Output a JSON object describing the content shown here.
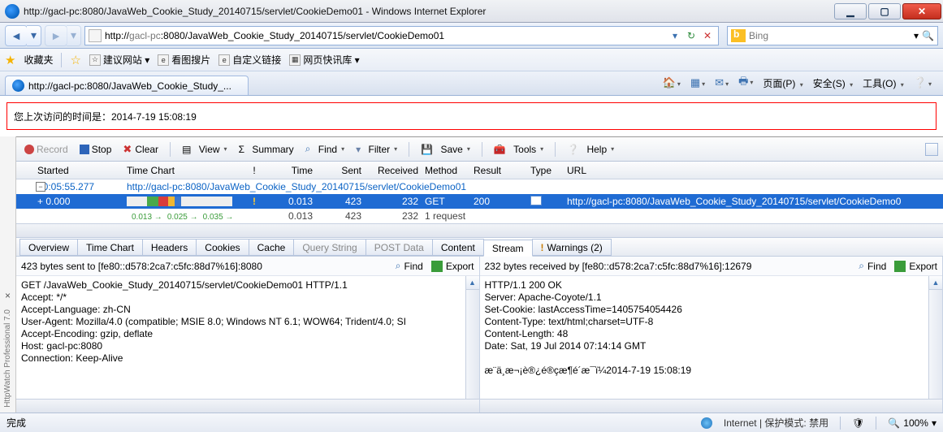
{
  "window": {
    "title": "http://gacl-pc:8080/JavaWeb_Cookie_Study_20140715/servlet/CookieDemo01 - Windows Internet Explorer",
    "url_dark1": "http://",
    "url_light1": "gacl-pc",
    "url_dark2": ":8080/JavaWeb_Cookie_Study_20140715/servlet/CookieDemo01",
    "search_hint": "Bing"
  },
  "fav": {
    "label": "收藏夹",
    "items": [
      "建议网站 ▾",
      "看图搜片",
      "自定义链接",
      "网页快讯库 ▾"
    ]
  },
  "tab": {
    "title": "http://gacl-pc:8080/JavaWeb_Cookie_Study_..."
  },
  "cmd": {
    "page": "页面(P)",
    "safety": "安全(S)",
    "tools": "工具(O)"
  },
  "page_text": "您上次访问的时间是：2014-7-19 15:08:19",
  "hw": {
    "buttons": {
      "record": "Record",
      "stop": "Stop",
      "clear": "Clear",
      "view": "View",
      "summary": "Summary",
      "find": "Find",
      "filter": "Filter",
      "save": "Save",
      "tools": "Tools",
      "help": "Help"
    },
    "cols": {
      "started": "Started",
      "chart": "Time Chart",
      "ex": "!",
      "time": "Time",
      "sent": "Sent",
      "recv": "Received",
      "meth": "Method",
      "res": "Result",
      "type": "Type",
      "url": "URL"
    },
    "rows": {
      "r0_start": "00:05:55.277",
      "r0_url": "http://gacl-pc:8080/JavaWeb_Cookie_Study_20140715/servlet/CookieDemo01",
      "r1_start": "+ 0.000",
      "r1_ex": "!",
      "r1_time": "0.013",
      "r1_sent": "423",
      "r1_recv": "232",
      "r1_meth": "GET",
      "r1_res": "200",
      "r1_url": "http://gacl-pc:8080/JavaWeb_Cookie_Study_20140715/servlet/CookieDemo0",
      "r2_c1": "0.013 →",
      "r2_c2": "0.025 →",
      "r2_c3": "0.035 →",
      "r2_time": "0.013",
      "r2_sent": "423",
      "r2_recv": "232",
      "r2_meth": "1 request"
    },
    "tabs": {
      "overview": "Overview",
      "chart": "Time Chart",
      "headers": "Headers",
      "cookies": "Cookies",
      "cache": "Cache",
      "query": "Query String",
      "post": "POST Data",
      "content": "Content",
      "stream": "Stream",
      "warnings": "Warnings (2)"
    },
    "sent_info": "423 bytes sent to [fe80::d578:2ca7:c5fc:88d7%16]:8080",
    "recv_info": "232 bytes received by [fe80::d578:2ca7:c5fc:88d7%16]:12679",
    "find": "Find",
    "export": "Export",
    "side_label": "HttpWatch Professional 7.0",
    "req": "GET /JavaWeb_Cookie_Study_20140715/servlet/CookieDemo01 HTTP/1.1\nAccept: */*\nAccept-Language: zh-CN\nUser-Agent: Mozilla/4.0 (compatible; MSIE 8.0; Windows NT 6.1; WOW64; Trident/4.0; SI\nAccept-Encoding: gzip, deflate\nHost: gacl-pc:8080\nConnection: Keep-Alive\n",
    "res": "HTTP/1.1 200 OK\nServer: Apache-Coyote/1.1\nSet-Cookie: lastAccessTime=1405754054426\nContent-Type: text/html;charset=UTF-8\nContent-Length: 48\nDate: Sat, 19 Jul 2014 07:14:14 GMT\n\næ¨ä¸æ¬¡è®¿é®çæ¶é´æ¯ï¼2014-7-19 15:08:19"
  },
  "status": {
    "done": "完成",
    "zone": "Internet | 保护模式: 禁用",
    "zoom": "100%"
  }
}
